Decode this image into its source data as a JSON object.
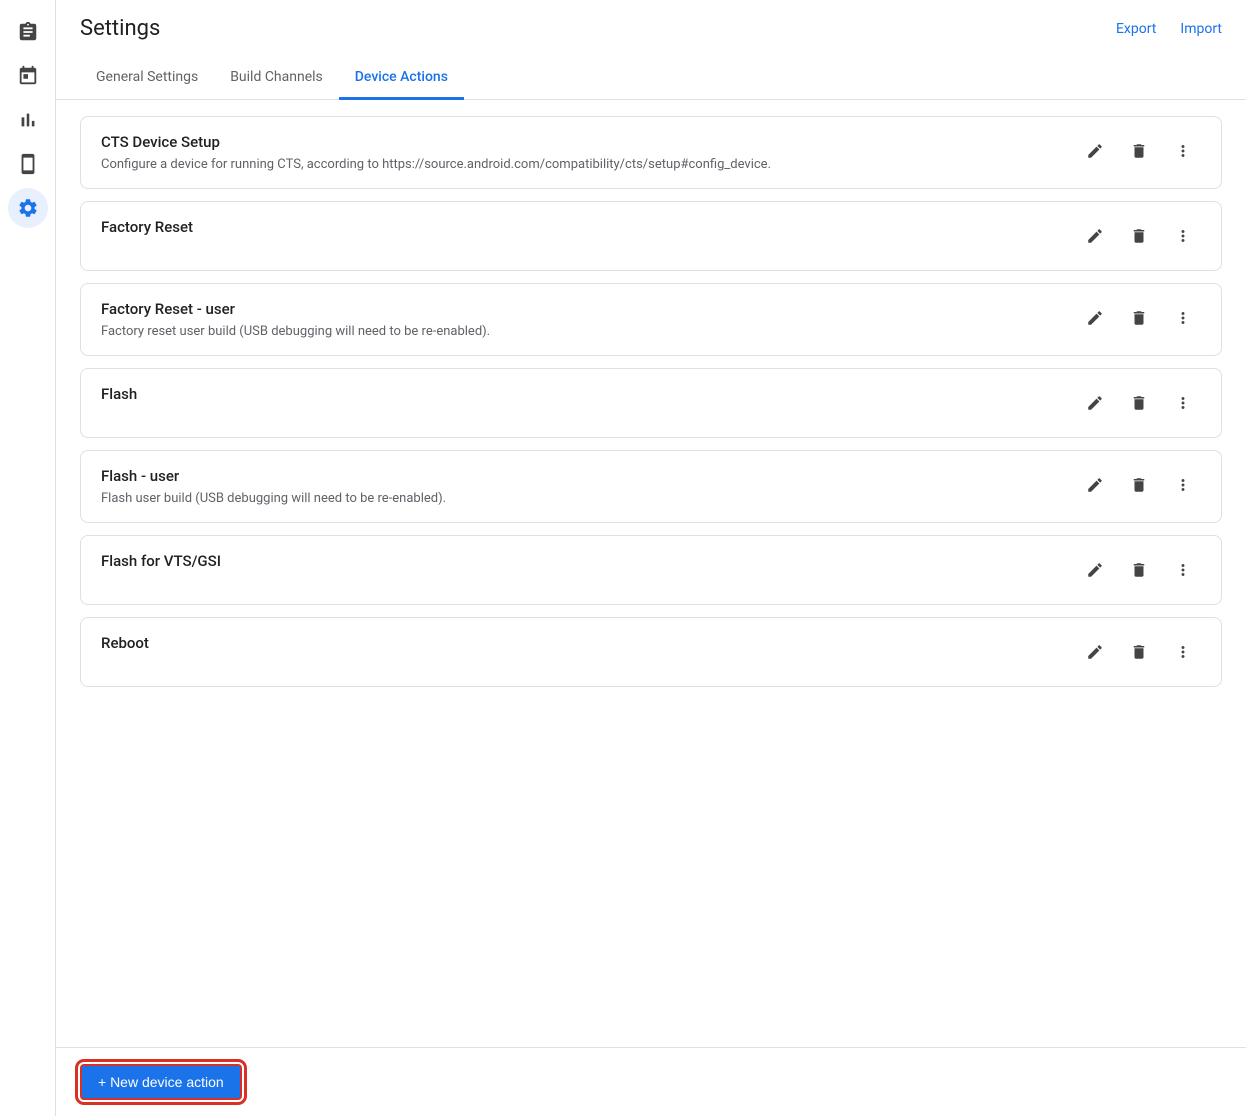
{
  "header": {
    "title": "Settings",
    "export_label": "Export",
    "import_label": "Import"
  },
  "tabs": [
    {
      "id": "general",
      "label": "General Settings",
      "active": false
    },
    {
      "id": "build-channels",
      "label": "Build Channels",
      "active": false
    },
    {
      "id": "device-actions",
      "label": "Device Actions",
      "active": true
    }
  ],
  "sidebar": {
    "items": [
      {
        "id": "clipboard",
        "icon": "clipboard",
        "active": false
      },
      {
        "id": "calendar",
        "icon": "calendar",
        "active": false
      },
      {
        "id": "chart",
        "icon": "chart",
        "active": false
      },
      {
        "id": "device",
        "icon": "device",
        "active": false
      },
      {
        "id": "settings",
        "icon": "settings",
        "active": true
      }
    ]
  },
  "device_actions": [
    {
      "id": "cts-device-setup",
      "title": "CTS Device Setup",
      "description": "Configure a device for running CTS, according to https://source.android.com/compatibility/cts/setup#config_device."
    },
    {
      "id": "factory-reset",
      "title": "Factory Reset",
      "description": ""
    },
    {
      "id": "factory-reset-user",
      "title": "Factory Reset - user",
      "description": "Factory reset user build (USB debugging will need to be re-enabled)."
    },
    {
      "id": "flash",
      "title": "Flash",
      "description": ""
    },
    {
      "id": "flash-user",
      "title": "Flash - user",
      "description": "Flash user build (USB debugging will need to be re-enabled)."
    },
    {
      "id": "flash-vts-gsi",
      "title": "Flash for VTS/GSI",
      "description": ""
    },
    {
      "id": "reboot",
      "title": "Reboot",
      "description": ""
    }
  ],
  "footer": {
    "new_action_label": "+ New device action"
  }
}
